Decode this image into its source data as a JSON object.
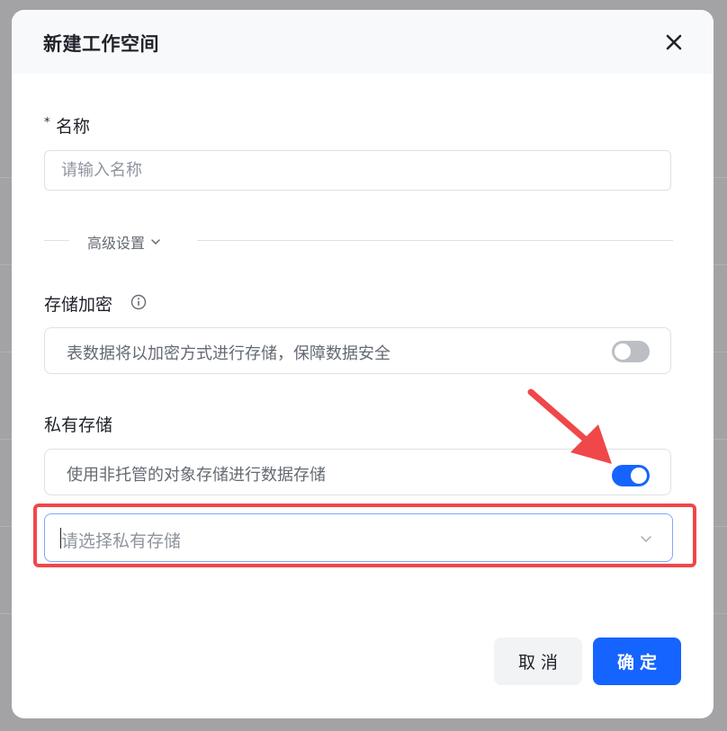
{
  "dialog": {
    "title": "新建工作空间"
  },
  "name_field": {
    "required_mark": "*",
    "label": "名称",
    "placeholder": "请输入名称",
    "value": ""
  },
  "advanced": {
    "label": "高级设置",
    "icon": "chevron-down-icon"
  },
  "encryption": {
    "label": "存储加密",
    "info_icon": "info-circle-icon",
    "description": "表数据将以加密方式进行存储，保障数据安全",
    "enabled": false
  },
  "private_storage": {
    "label": "私有存储",
    "description": "使用非托管的对象存储进行数据存储",
    "enabled": true,
    "select_placeholder": "请选择私有存储",
    "select_value": ""
  },
  "footer": {
    "cancel_label": "取消",
    "confirm_label": "确定"
  },
  "colors": {
    "primary": "#1664ff",
    "annotation_red": "#f0474a",
    "toggle_off": "#bbbfc4"
  }
}
